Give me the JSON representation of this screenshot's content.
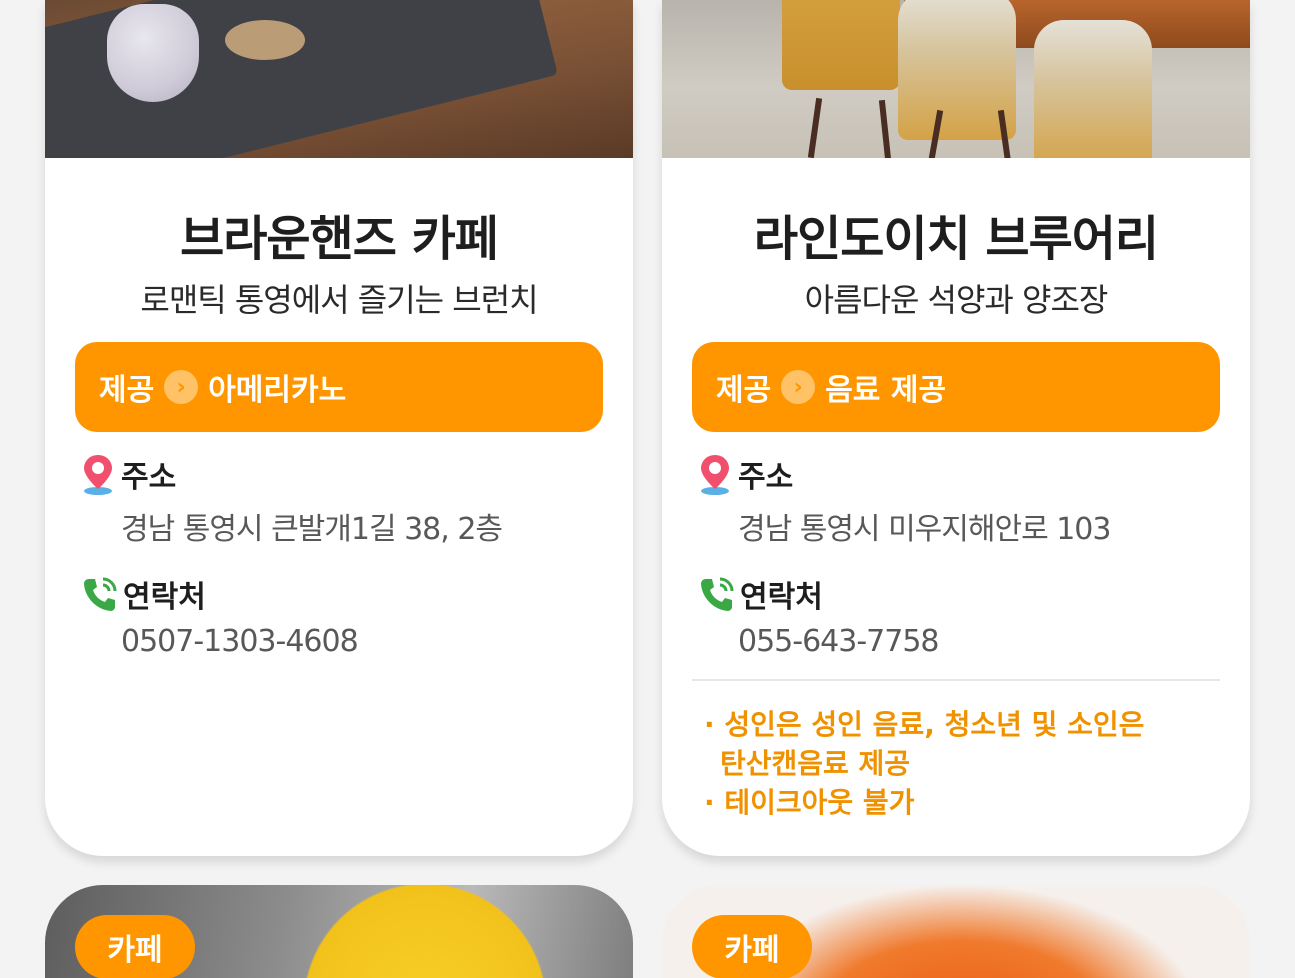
{
  "cards": [
    {
      "title": "브라운핸즈 카페",
      "subtitle": "로맨틱 통영에서 즐기는 브런치",
      "provide_label": "제공",
      "provide_value": "아메리카노",
      "address_label": "주소",
      "address": "경남 통영시 큰발개1길 38, 2층",
      "contact_label": "연락처",
      "phone": "0507-1303-4608"
    },
    {
      "title": "라인도이치 브루어리",
      "subtitle": "아름다운 석양과 양조장",
      "provide_label": "제공",
      "provide_value": "음료 제공",
      "address_label": "주소",
      "address": "경남 통영시 미우지해안로 103",
      "contact_label": "연락처",
      "phone": "055-643-7758",
      "notes": [
        "· 성인은 성인 음료, 청소년 및 소인은",
        "탄산캔음료 제공",
        "· 테이크아웃 불가"
      ]
    }
  ],
  "next_cards": [
    {
      "tag": "카페"
    },
    {
      "tag": "카페"
    }
  ],
  "colors": {
    "accent": "#ff9600",
    "note_text": "#f09200",
    "pin_icon": "#f0506e",
    "phone_icon": "#3aa845"
  },
  "icons": [
    "location-pin-icon",
    "phone-icon",
    "chevron-right-icon"
  ]
}
